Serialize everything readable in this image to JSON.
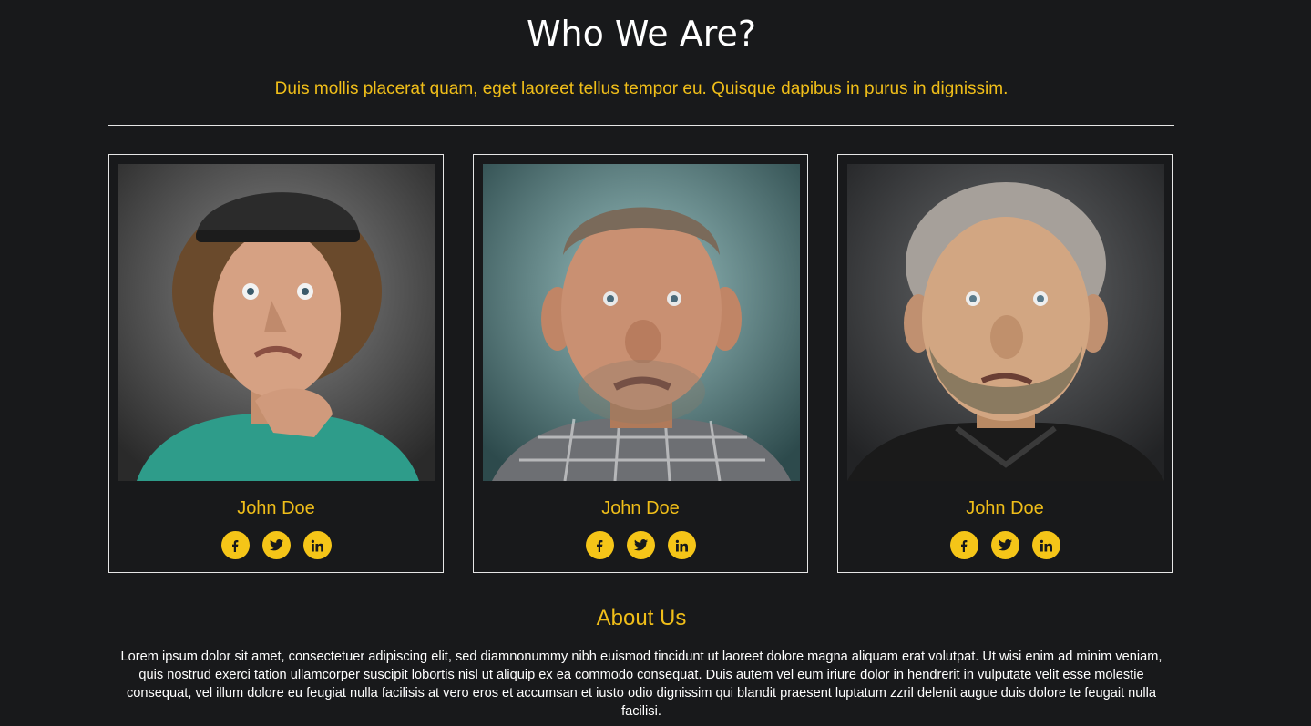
{
  "header": {
    "title": "Who We Are?",
    "subtitle": "Duis mollis placerat quam, eget laoreet tellus tempor eu. Quisque dapibus in purus in dignissim."
  },
  "team": [
    {
      "name": "John Doe",
      "photo_alt": "team-member-photo",
      "socials": [
        "facebook-icon",
        "twitter-icon",
        "linkedin-icon"
      ]
    },
    {
      "name": "John Doe",
      "photo_alt": "team-member-photo",
      "socials": [
        "facebook-icon",
        "twitter-icon",
        "linkedin-icon"
      ]
    },
    {
      "name": "John Doe",
      "photo_alt": "team-member-photo",
      "socials": [
        "facebook-icon",
        "twitter-icon",
        "linkedin-icon"
      ]
    }
  ],
  "about": {
    "title": "About Us",
    "text": "Lorem ipsum dolor sit amet, consectetuer adipiscing elit, sed diamnonummy nibh euismod tincidunt ut laoreet dolore magna aliquam erat volutpat. Ut wisi enim ad minim veniam, quis nostrud exerci tation ullamcorper suscipit lobortis nisl ut aliquip ex ea commodo consequat. Duis autem vel eum iriure dolor in hendrerit in vulputate velit esse molestie consequat, vel illum dolore eu feugiat nulla facilisis at vero eros et accumsan et iusto odio dignissim qui blandit praesent luptatum zzril delenit augue duis dolore te feugait nulla facilisi."
  },
  "colors": {
    "background": "#18191b",
    "accent": "#f0be19",
    "text": "#ffffff",
    "border": "#e6e6e6"
  }
}
